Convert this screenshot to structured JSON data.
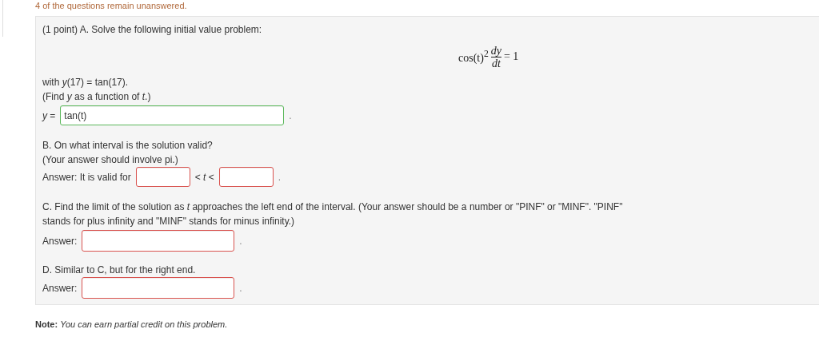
{
  "notice": "4 of the questions remain unanswered.",
  "problem": {
    "intro": "(1 point) A. Solve the following initial value problem:",
    "equation": {
      "lhs": "cos(t)",
      "exponent": "2",
      "numerator": "dy",
      "denominator": "dt",
      "rhs": "= 1"
    },
    "condition": "with *y*(17) = tan(17).",
    "hint": "(Find *y* as a function of *t*.)",
    "answer_a": {
      "label": "*y* =",
      "value": "tan(t)",
      "correct": true,
      "suffix": "."
    },
    "part_b": {
      "question": "B. On what interval is the solution valid?",
      "hint": "(Your answer should involve pi.)",
      "label": "Answer: It is valid for",
      "between": "< *t* <",
      "suffix": ".",
      "fields": [
        {
          "correct": false
        },
        {
          "correct": false
        }
      ]
    },
    "part_c": {
      "question": "C. Find the limit of the solution as *t* approaches the left end of the interval. (Your answer should be a number or \"PINF\" or \"MINF\". \"PINF\" stands for plus infinity and \"MINF\" stands for minus infinity.)",
      "label": "Answer:",
      "correct": false,
      "suffix": "."
    },
    "part_d": {
      "question": "D. Similar to C, but for the right end.",
      "label": "Answer:",
      "correct": false,
      "suffix": "."
    }
  },
  "note": "**Note:** *You can earn partial credit on this problem.*"
}
